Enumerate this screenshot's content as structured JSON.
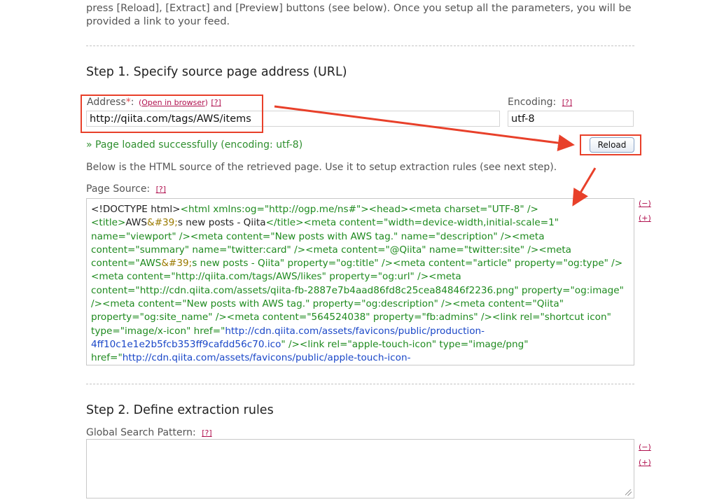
{
  "intro": {
    "line1": "press [Reload], [Extract] and [Preview] buttons (see below). Once you setup all the parameters, you will be",
    "line2": "provided a link to your feed."
  },
  "step1": {
    "title": "Step 1. Specify source page address (URL)",
    "address_label": "Address",
    "required_mark": "*",
    "colon": ":",
    "open_link": "Open in browser",
    "help": "[?]",
    "address_value": "http://qiita.com/tags/AWS/items",
    "encoding_label": "Encoding:",
    "encoding_value": "utf-8",
    "reload_label": "Reload",
    "success_msg": "» Page loaded successfully (encoding: utf-8)",
    "description": "Below is the HTML source of the retrieved page. Use it to setup extraction rules (see next step).",
    "page_source_label": "Page Source:",
    "collapse": "(−)",
    "expand": "(+)",
    "source_segments": [
      {
        "c": "k",
        "t": "<!DOCTYPE html>"
      },
      {
        "c": "g",
        "t": "<html xmlns:og=\"http://ogp.me/ns#\"><head><meta charset=\"UTF-8\" /> <title>"
      },
      {
        "c": "k",
        "t": "AWS"
      },
      {
        "c": "y",
        "t": "&#39;"
      },
      {
        "c": "k",
        "t": "s new posts - Qiita"
      },
      {
        "c": "g",
        "t": "</title><meta content=\"width=device-width,initial-scale=1\" name=\"viewport\" /><meta content=\"New posts with AWS tag.\" name=\"description\" /><meta content=\"summary\" name=\"twitter:card\" /><meta content=\"@Qiita\" name=\"twitter:site\" /><meta content=\"AWS"
      },
      {
        "c": "y",
        "t": "&#39;"
      },
      {
        "c": "g",
        "t": "s new posts - Qiita\" property=\"og:title\" /><meta content=\"article\" property=\"og:type\" /><meta content=\"http://qiita.com/tags/AWS/likes\" property=\"og:url\" /><meta content=\"http://cdn.qiita.com/assets/qiita-fb-2887e7b4aad86fd8c25cea84846f2236.png\" property=\"og:image\" /><meta content=\"New posts with AWS tag.\" property=\"og:description\" /><meta content=\"Qiita\" property=\"og:site_name\" /><meta content=\"564524038\" property=\"fb:admins\" /><link rel=\"shortcut icon\" type=\"image/x-icon\" href=\""
      },
      {
        "c": "b",
        "t": "http://cdn.qiita.com/assets/favicons/public/production-4ff10c1e1e2b5fcb353ff9cafdd56c70.ico"
      },
      {
        "c": "g",
        "t": "\" /><link rel=\"apple-touch-icon\" type=\"image/png\" href=\""
      },
      {
        "c": "b",
        "t": "http://cdn.qiita.com/assets/favicons/public/apple-touch-icon-"
      }
    ]
  },
  "step2": {
    "title": "Step 2. Define extraction rules",
    "global_label": "Global Search Pattern:",
    "help": "[?]",
    "collapse": "(−)",
    "expand": "(+)"
  },
  "annotation": {
    "color": "#e8402a"
  }
}
